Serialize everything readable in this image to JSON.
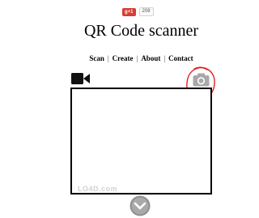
{
  "social": {
    "gplus_label": "g+1",
    "gplus_count": "208"
  },
  "header": {
    "title": "QR Code scanner"
  },
  "nav": {
    "items": [
      {
        "label": "Scan"
      },
      {
        "label": "Create"
      },
      {
        "label": "About"
      },
      {
        "label": "Contact"
      }
    ],
    "separator": "|"
  },
  "icons": {
    "video": "video-camera-icon",
    "camera": "photo-camera-icon",
    "annotation": "red-annotation-circle",
    "more": "chevron-down-icon"
  },
  "colors": {
    "gplus_red": "#d73d32",
    "annotation_red": "#e02020",
    "camera_gray": "#a8a8a8",
    "button_gray": "#8f8f8f"
  },
  "watermark": {
    "text": "LO4D.com"
  }
}
